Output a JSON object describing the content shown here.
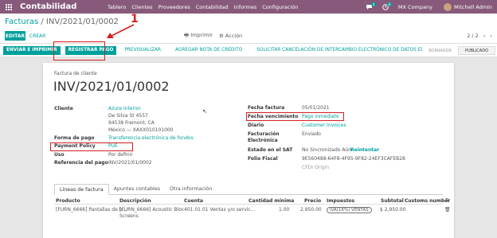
{
  "navbar": {
    "brand": "Contabilidad",
    "menu": [
      "Tablero",
      "Clientes",
      "Proveedores",
      "Contabilidad",
      "Informes",
      "Configuración"
    ],
    "chat_badge": "4",
    "activity_badge": "6",
    "company": "MX Company",
    "user": "Mitchell Admin"
  },
  "breadcrumb": {
    "parent": "Facturas",
    "separator": "/",
    "current": "INV/2021/01/0002"
  },
  "control": {
    "edit_label": "EDITAR",
    "create_label": "CREAR",
    "print_label": "Imprimir",
    "action_label": "Acción",
    "pager": "2 / 2"
  },
  "statusbar": {
    "buttons": [
      "ENVIAR E IMPRIMIR",
      "REGISTRAR PAGO",
      "PREVISUALIZAR",
      "AGREGAR NOTA DE CRÉDITO",
      "SOLICITAR CANCELACIÓN DE INTERCAMBIO ELECTRÓNICO DE DATOS EDI"
    ],
    "stages": [
      "BORRADOR",
      "PUBLICADO"
    ]
  },
  "invoice": {
    "subtitle": "Factura de cliente",
    "number": "INV/2021/01/0002",
    "cliente_label": "Cliente",
    "cliente_name": "Azure Interior",
    "cliente_addr1": "De Silva St 4557",
    "cliente_addr2": "94538 Fremont, CA",
    "cliente_addr3": "México — XAXX010101000",
    "forma_pago_label": "Forma de pago",
    "forma_pago": "Transferencia electrónica de fondos",
    "payment_policy_label": "Payment Policy",
    "payment_policy": "PUE",
    "uso_label": "Uso",
    "uso": "Por definir",
    "referencia_label": "Referencia del pago",
    "referencia": "INV/2021/01/0002",
    "fecha_factura_label": "Fecha factura",
    "fecha_factura": "05/01/2021",
    "fecha_venc_label": "Fecha vencimiento",
    "fecha_venc": "Pago inmediato",
    "diario_label": "Diario",
    "diario": "Customer Invoices",
    "facturacion_label": "Facturación Electrónica",
    "facturacion": "Enviado",
    "sat_label": "Estado en el SAT",
    "sat": "No Sincronizado Aún",
    "reintentar": "Reintentar",
    "folio_label": "Folio Fiscal",
    "folio": "9E560488-64F8-4F95-9F82-24EF3CAFEB28",
    "origin": "CFDI Origin"
  },
  "tabs": [
    "Líneas de factura",
    "Apuntes contables",
    "Otra información"
  ],
  "table": {
    "headers": [
      "Producto",
      "Descripción",
      "Cuenta",
      "Cantidad mínima",
      "Precio",
      "Impuestos",
      "Subtotal",
      "Customs number"
    ],
    "row": {
      "producto": "[FURN_6666] Pantallas de b...",
      "descripcion1": "[FURN_6666] Acoustic Bloc",
      "descripcion2": "Screens",
      "cuenta": "401.01.01 Ventas y/o servic...",
      "cantidad": "1.00",
      "precio": "2,950.00",
      "impuestos": "IVA(16%) VENTAS",
      "subtotal": "$ 2,950.00"
    }
  },
  "annotation": {
    "number": "1"
  },
  "colors": {
    "brand": "#875a7b",
    "accent": "#00a09d",
    "annotation": "#d32020"
  }
}
